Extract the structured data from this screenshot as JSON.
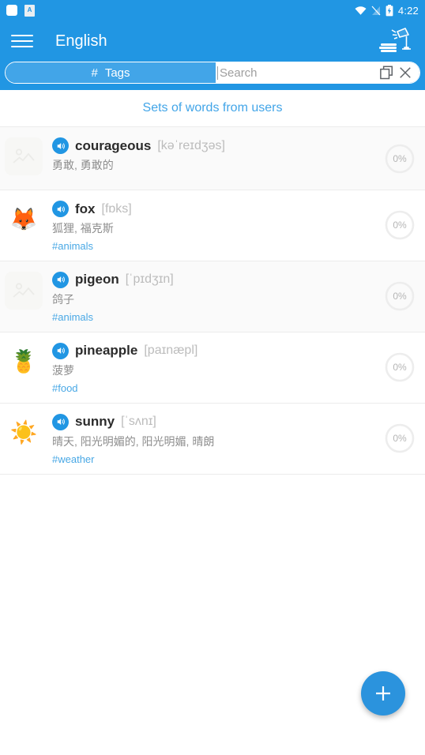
{
  "status_bar": {
    "time": "4:22",
    "icons": [
      "notification-square",
      "notification-doc",
      "wifi-icon",
      "signal-off-icon",
      "battery-charging-icon"
    ],
    "doc_letter": "A"
  },
  "app_bar": {
    "menu_icon": "hamburger-menu-icon",
    "title": "English",
    "right_icon": "lamp-books-icon"
  },
  "search": {
    "tags_label": "Tags",
    "tags_hash": "#",
    "placeholder": "Search",
    "value": "",
    "copy_icon": "copy-icon",
    "close_icon": "close-icon"
  },
  "section": {
    "title": "Sets of words from users"
  },
  "fab": {
    "icon": "plus-icon",
    "label": "+"
  },
  "colors": {
    "primary": "#2196e3",
    "primary_light": "#42a5e8",
    "link": "#49a8e5",
    "fab": "#2b93dd"
  },
  "words": [
    {
      "term": "courageous",
      "ipa": "[kəˈreɪdʒəs]",
      "translation": "勇敢, 勇敢的",
      "tag": "",
      "progress": "0%",
      "thumb": "placeholder-image-icon",
      "emoji": "",
      "has_image": false
    },
    {
      "term": "fox",
      "ipa": "[fɒks]",
      "translation": "狐狸, 福克斯",
      "tag": "#animals",
      "progress": "0%",
      "thumb": "fox-image",
      "emoji": "🦊",
      "has_image": true
    },
    {
      "term": "pigeon",
      "ipa": "[ˈpɪdʒɪn]",
      "translation": "鸽子",
      "tag": "#animals",
      "progress": "0%",
      "thumb": "placeholder-image-icon",
      "emoji": "",
      "has_image": false
    },
    {
      "term": "pineapple",
      "ipa": "[paɪnæpl]",
      "translation": "菠萝",
      "tag": "#food",
      "progress": "0%",
      "thumb": "pineapple-image",
      "emoji": "🍍",
      "has_image": true
    },
    {
      "term": "sunny",
      "ipa": "[ˈsʌnɪ]",
      "translation": "晴天, 阳光明媚的, 阳光明媚, 晴朗",
      "tag": "#weather",
      "progress": "0%",
      "thumb": "sun-image",
      "emoji": "☀️",
      "has_image": true
    }
  ]
}
